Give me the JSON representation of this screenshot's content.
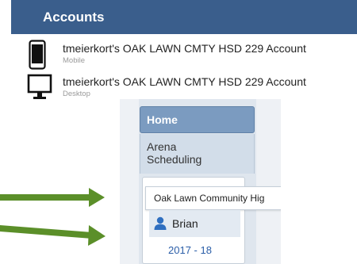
{
  "accounts": {
    "title": "Accounts",
    "items": [
      {
        "name": "tmeierkort's OAK LAWN CMTY HSD 229 Account",
        "type": "Mobile",
        "icon": "mobile-phone-icon"
      },
      {
        "name": "tmeierkort's OAK LAWN CMTY HSD 229 Account",
        "type": "Desktop",
        "icon": "desktop-monitor-icon"
      }
    ]
  },
  "sidebar": {
    "home_label": "Home",
    "arena_label": "Arena Scheduling",
    "org_label": "Oak Lawn Community Hig",
    "user": {
      "name": "Brian",
      "icon": "user-icon"
    },
    "season_label": "2017 - 18"
  },
  "annotations": {
    "arrow_icon": "arrow-right-icon",
    "arrow_color": "#5b8f29"
  },
  "colors": {
    "accounts_header": "#3a5e8c",
    "home_button": "#7b9bc0",
    "link_blue": "#2b5ea8",
    "user_icon": "#2f6fc0"
  }
}
